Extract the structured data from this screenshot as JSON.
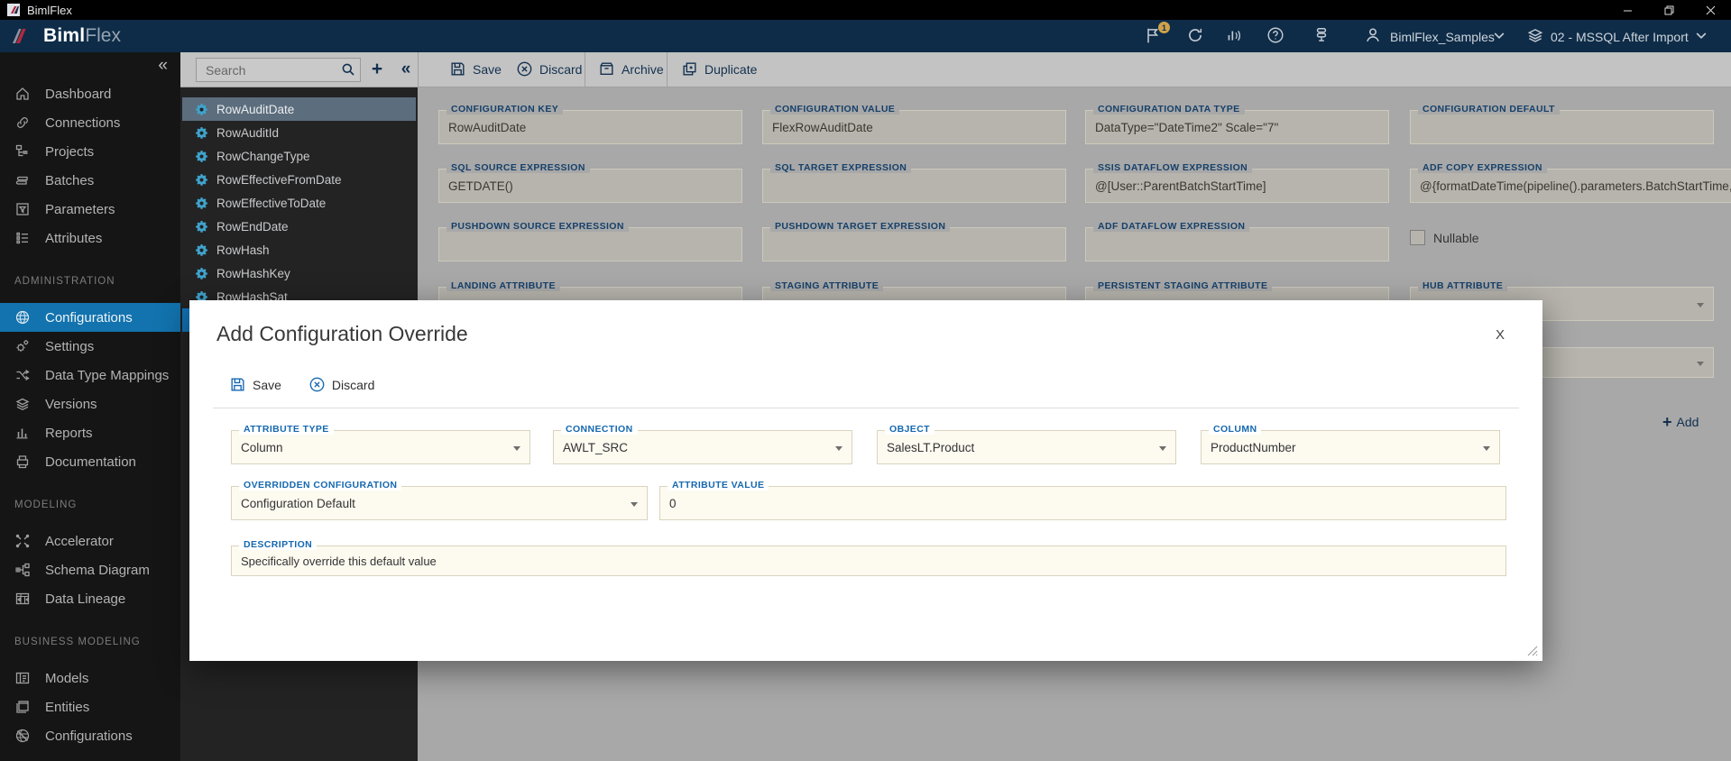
{
  "titlebar": {
    "app_name": "BimlFlex"
  },
  "header": {
    "brand_bold": "Biml",
    "brand_light": "Flex",
    "notification_count": "1",
    "account_name": "BimlFlex_Samples",
    "environment_name": "02 - MSSQL After Import"
  },
  "sidebar": {
    "collapse_glyph": "«",
    "sections": {
      "administration": "ADMINISTRATION",
      "modeling": "MODELING",
      "business_modeling": "BUSINESS MODELING"
    },
    "items": {
      "dashboard": "Dashboard",
      "connections": "Connections",
      "projects": "Projects",
      "batches": "Batches",
      "parameters": "Parameters",
      "attributes": "Attributes",
      "configurations": "Configurations",
      "settings": "Settings",
      "data_type_mappings": "Data Type Mappings",
      "versions": "Versions",
      "reports": "Reports",
      "documentation": "Documentation",
      "accelerator": "Accelerator",
      "schema_diagram": "Schema Diagram",
      "data_lineage": "Data Lineage",
      "models": "Models",
      "entities": "Entities",
      "configurations_biz": "Configurations"
    }
  },
  "list_panel": {
    "search_placeholder": "Search",
    "collapse_glyph": "«",
    "add_glyph": "+",
    "items": [
      "RowAuditDate",
      "RowAuditId",
      "RowChangeType",
      "RowEffectiveFromDate",
      "RowEffectiveToDate",
      "RowEndDate",
      "RowHash",
      "RowHashKey",
      "RowHashSat"
    ],
    "selected_item": "RowAuditDate"
  },
  "toolbar": {
    "save": "Save",
    "discard": "Discard",
    "archive": "Archive",
    "duplicate": "Duplicate"
  },
  "form": {
    "configuration_key": {
      "label": "CONFIGURATION KEY",
      "value": "RowAuditDate"
    },
    "configuration_value": {
      "label": "CONFIGURATION VALUE",
      "value": "FlexRowAuditDate"
    },
    "configuration_data_type": {
      "label": "CONFIGURATION DATA TYPE",
      "value": "DataType=\"DateTime2\" Scale=\"7\""
    },
    "configuration_default": {
      "label": "CONFIGURATION DEFAULT",
      "value": ""
    },
    "sql_source_expression": {
      "label": "SQL SOURCE EXPRESSION",
      "value": "GETDATE()"
    },
    "sql_target_expression": {
      "label": "SQL TARGET EXPRESSION",
      "value": ""
    },
    "ssis_dataflow_expression": {
      "label": "SSIS DATAFLOW EXPRESSION",
      "value": "@[User::ParentBatchStartTime]"
    },
    "adf_copy_expression": {
      "label": "ADF COPY EXPRESSION",
      "value": "@{formatDateTime(pipeline().parameters.BatchStartTime, 'yyyy-"
    },
    "pushdown_source_expression": {
      "label": "PUSHDOWN SOURCE EXPRESSION",
      "value": ""
    },
    "pushdown_target_expression": {
      "label": "PUSHDOWN TARGET EXPRESSION",
      "value": ""
    },
    "adf_dataflow_expression": {
      "label": "ADF DATAFLOW EXPRESSION",
      "value": ""
    },
    "nullable_label": "Nullable",
    "landing_attribute": {
      "label": "LANDING ATTRIBUTE",
      "value": ""
    },
    "staging_attribute": {
      "label": "STAGING ATTRIBUTE",
      "value": ""
    },
    "persistent_staging_attribute": {
      "label": "PERSISTENT STAGING ATTRIBUTE",
      "value": ""
    },
    "hub_attribute": {
      "label": "HUB ATTRIBUTE",
      "value": ""
    },
    "add_plus": "+",
    "add_button": "Add"
  },
  "modal": {
    "title": "Add Configuration Override",
    "close": "X",
    "save": "Save",
    "discard": "Discard",
    "fields": {
      "attribute_type": {
        "label": "ATTRIBUTE TYPE",
        "value": "Column"
      },
      "connection": {
        "label": "CONNECTION",
        "value": "AWLT_SRC"
      },
      "object": {
        "label": "OBJECT",
        "value": "SalesLT.Product"
      },
      "column": {
        "label": "COLUMN",
        "value": "ProductNumber"
      },
      "overridden_configuration": {
        "label": "OVERRIDDEN CONFIGURATION",
        "value": "Configuration Default"
      },
      "attribute_value": {
        "label": "ATTRIBUTE VALUE",
        "value": "0"
      },
      "description": {
        "label": "DESCRIPTION",
        "value": "Specifically override this default value"
      }
    }
  },
  "colors": {
    "accent_blue": "#1273ae",
    "header_navy": "#0e2c48",
    "modal_label_blue": "#1568b0",
    "brand_red": "#b5283c"
  }
}
